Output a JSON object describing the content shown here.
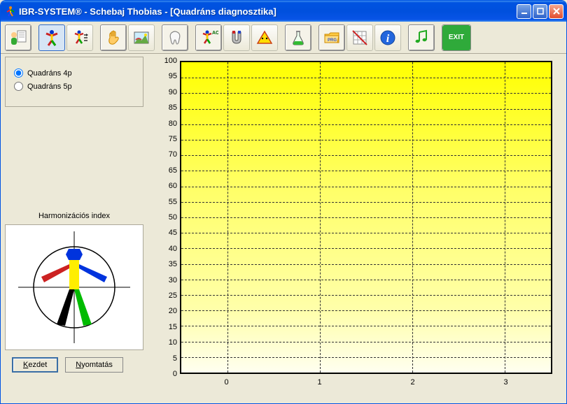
{
  "window": {
    "title": "IBR-SYSTEM® - Schebaj Thobias - [Quadráns diagnosztika]"
  },
  "toolbar": {
    "icons": [
      "person-doc-icon",
      "person-body-icon",
      "person-arrows-icon",
      "hand-icon",
      "landscape-icon",
      "tooth-icon",
      "person-ac-icon",
      "magnet-icon",
      "triangle-warning-icon",
      "flask-icon",
      "folder-prg-icon",
      "grid-cross-icon",
      "info-icon",
      "music-note-icon"
    ],
    "exit_label": "EXIT"
  },
  "sidebar": {
    "radio1": "Quadráns 4p",
    "radio2": "Quadráns 5p",
    "selected": "Quadráns 4p",
    "harmon_label": "Harmonizációs index"
  },
  "buttons": {
    "start": "Kezdet",
    "print": "Nyomtatás"
  },
  "chart_data": {
    "type": "bar",
    "categories": [
      "0",
      "1",
      "2",
      "3"
    ],
    "values": [
      0,
      0,
      0,
      0
    ],
    "xlabel": "",
    "ylabel": "",
    "ylim": [
      0,
      100
    ],
    "yticks": [
      0,
      5,
      10,
      15,
      20,
      25,
      30,
      35,
      40,
      45,
      50,
      55,
      60,
      65,
      70,
      75,
      80,
      85,
      90,
      95,
      100
    ],
    "xticks": [
      0,
      1,
      2,
      3
    ],
    "xrange": [
      -0.5,
      3.5
    ]
  }
}
